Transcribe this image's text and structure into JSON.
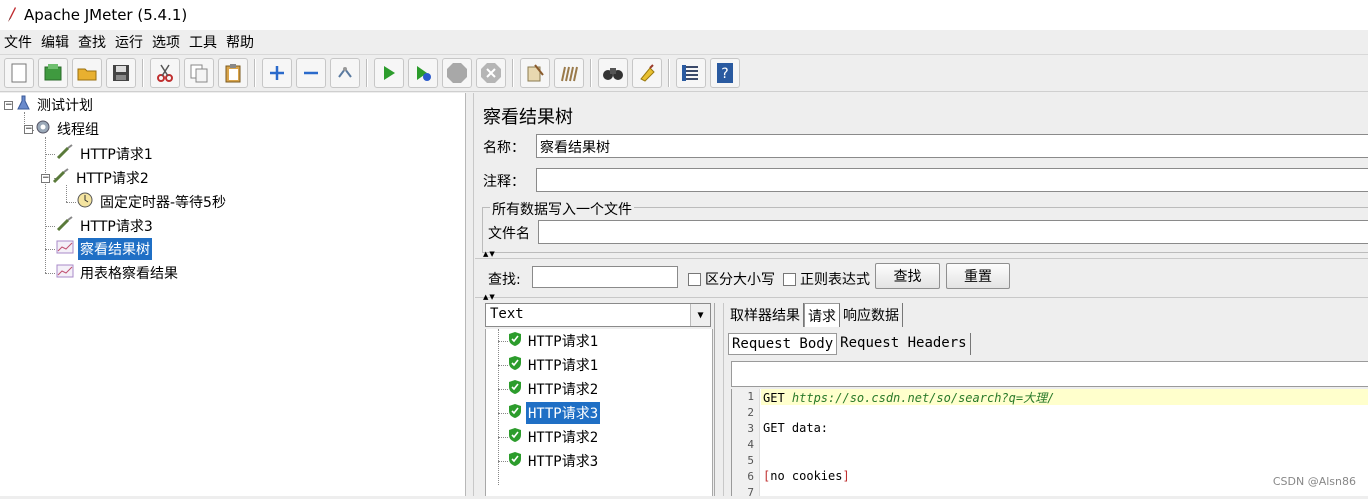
{
  "window": {
    "title": "Apache JMeter (5.4.1)"
  },
  "menu": [
    "文件",
    "编辑",
    "查找",
    "运行",
    "选项",
    "工具",
    "帮助"
  ],
  "toolbar": {
    "buttons": [
      "new-icon",
      "templates-icon",
      "open-icon",
      "save-icon",
      "cut-icon",
      "copy-icon",
      "paste-icon",
      "expand-icon",
      "collapse-icon",
      "toggle-icon",
      "start-icon",
      "start-no-pauses-icon",
      "stop-icon",
      "shutdown-icon",
      "clear-icon",
      "clear-all-icon",
      "search-icon",
      "reset-search-icon",
      "function-helper-icon",
      "help-icon"
    ]
  },
  "tree": {
    "items": [
      {
        "label": "测试计划"
      },
      {
        "label": "线程组"
      },
      {
        "label": "HTTP请求1"
      },
      {
        "label": "HTTP请求2"
      },
      {
        "label": "固定定时器-等待5秒"
      },
      {
        "label": "HTTP请求3"
      },
      {
        "label": "察看结果树"
      },
      {
        "label": "用表格察看结果"
      }
    ]
  },
  "panel": {
    "title": "察看结果树",
    "name_label": "名称：",
    "name_value": "察看结果树",
    "comment_label": "注释：",
    "comment_value": "",
    "group_title": "所有数据写入一个文件",
    "filename_label": "文件名",
    "filename_value": ""
  },
  "search": {
    "label": "查找:",
    "value": "",
    "case_label": "区分大小写",
    "regex_label": "正则表达式",
    "find_button": "查找",
    "reset_button": "重置"
  },
  "renderer": {
    "selected": "Text"
  },
  "results": [
    {
      "label": "HTTP请求1"
    },
    {
      "label": "HTTP请求1"
    },
    {
      "label": "HTTP请求2"
    },
    {
      "label": "HTTP请求3"
    },
    {
      "label": "HTTP请求2"
    },
    {
      "label": "HTTP请求3"
    }
  ],
  "tabs": [
    "取样器结果",
    "请求",
    "响应数据"
  ],
  "subtabs": [
    "Request Body",
    "Request Headers"
  ],
  "editor": {
    "lines": [
      {
        "n": "1",
        "prefix": "GET ",
        "url": "https://so.csdn.net/so/search?q=大理/"
      },
      {
        "n": "2",
        "text": ""
      },
      {
        "n": "3",
        "text": "GET data:"
      },
      {
        "n": "4",
        "text": ""
      },
      {
        "n": "5",
        "text": ""
      },
      {
        "n": "6",
        "text": "[no cookies]"
      },
      {
        "n": "7",
        "text": ""
      }
    ]
  },
  "watermark": "CSDN @Alsn86",
  "colors": {
    "selection": "#1f6fc5",
    "highlight_line": "#ffffcc",
    "url": "#2a7a2a",
    "success": "#2c9c2c"
  }
}
